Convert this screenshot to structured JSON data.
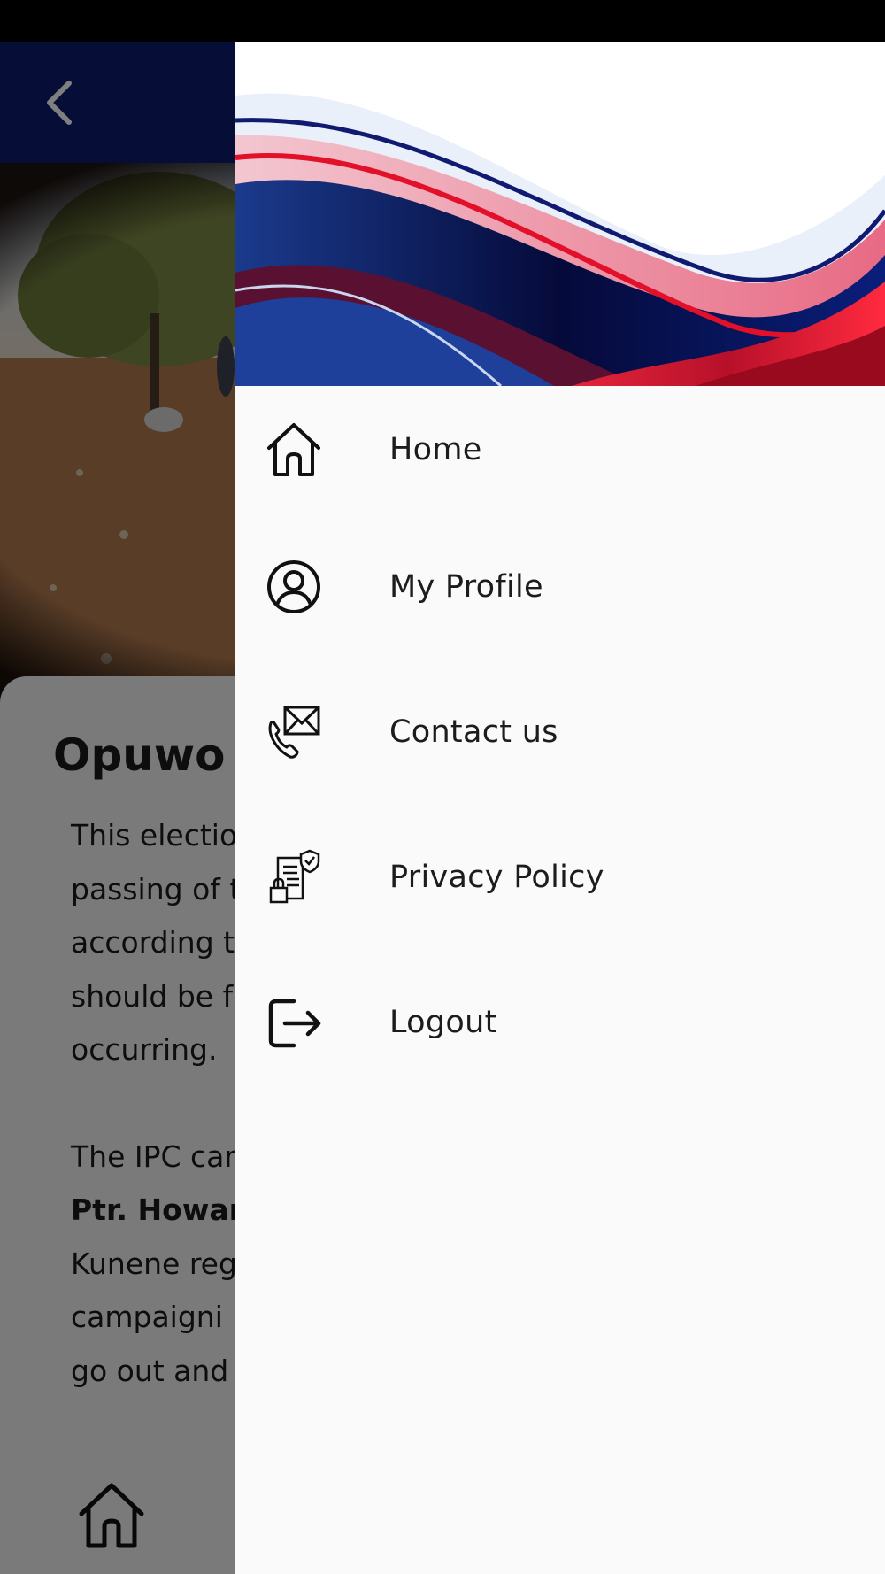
{
  "article": {
    "title": "Opuwo",
    "paragraphs": [
      "This electio",
      "passing of t",
      "according t",
      "should be f",
      "occurring."
    ],
    "paragraph2_line1": "The IPC car",
    "paragraph2_bold": "Ptr. Howard",
    "paragraph2_rest": [
      "Kunene reg",
      "campaigni",
      "go out and"
    ]
  },
  "icons": {
    "back": "chevron-left-icon",
    "bottom_nav_home": "home-icon"
  },
  "drawer": {
    "menu": [
      {
        "label": "Home",
        "icon": "home-icon"
      },
      {
        "label": "My Profile",
        "icon": "user-circle-icon"
      },
      {
        "label": "Contact us",
        "icon": "contact-phone-mail-icon"
      },
      {
        "label": "Privacy Policy",
        "icon": "privacy-document-icon"
      },
      {
        "label": "Logout",
        "icon": "logout-icon"
      }
    ]
  },
  "colors": {
    "app_bar": "#0c1a6e",
    "drawer_bg": "#fafafa",
    "brand_red": "#e0102e",
    "brand_navy": "#0a1160"
  }
}
